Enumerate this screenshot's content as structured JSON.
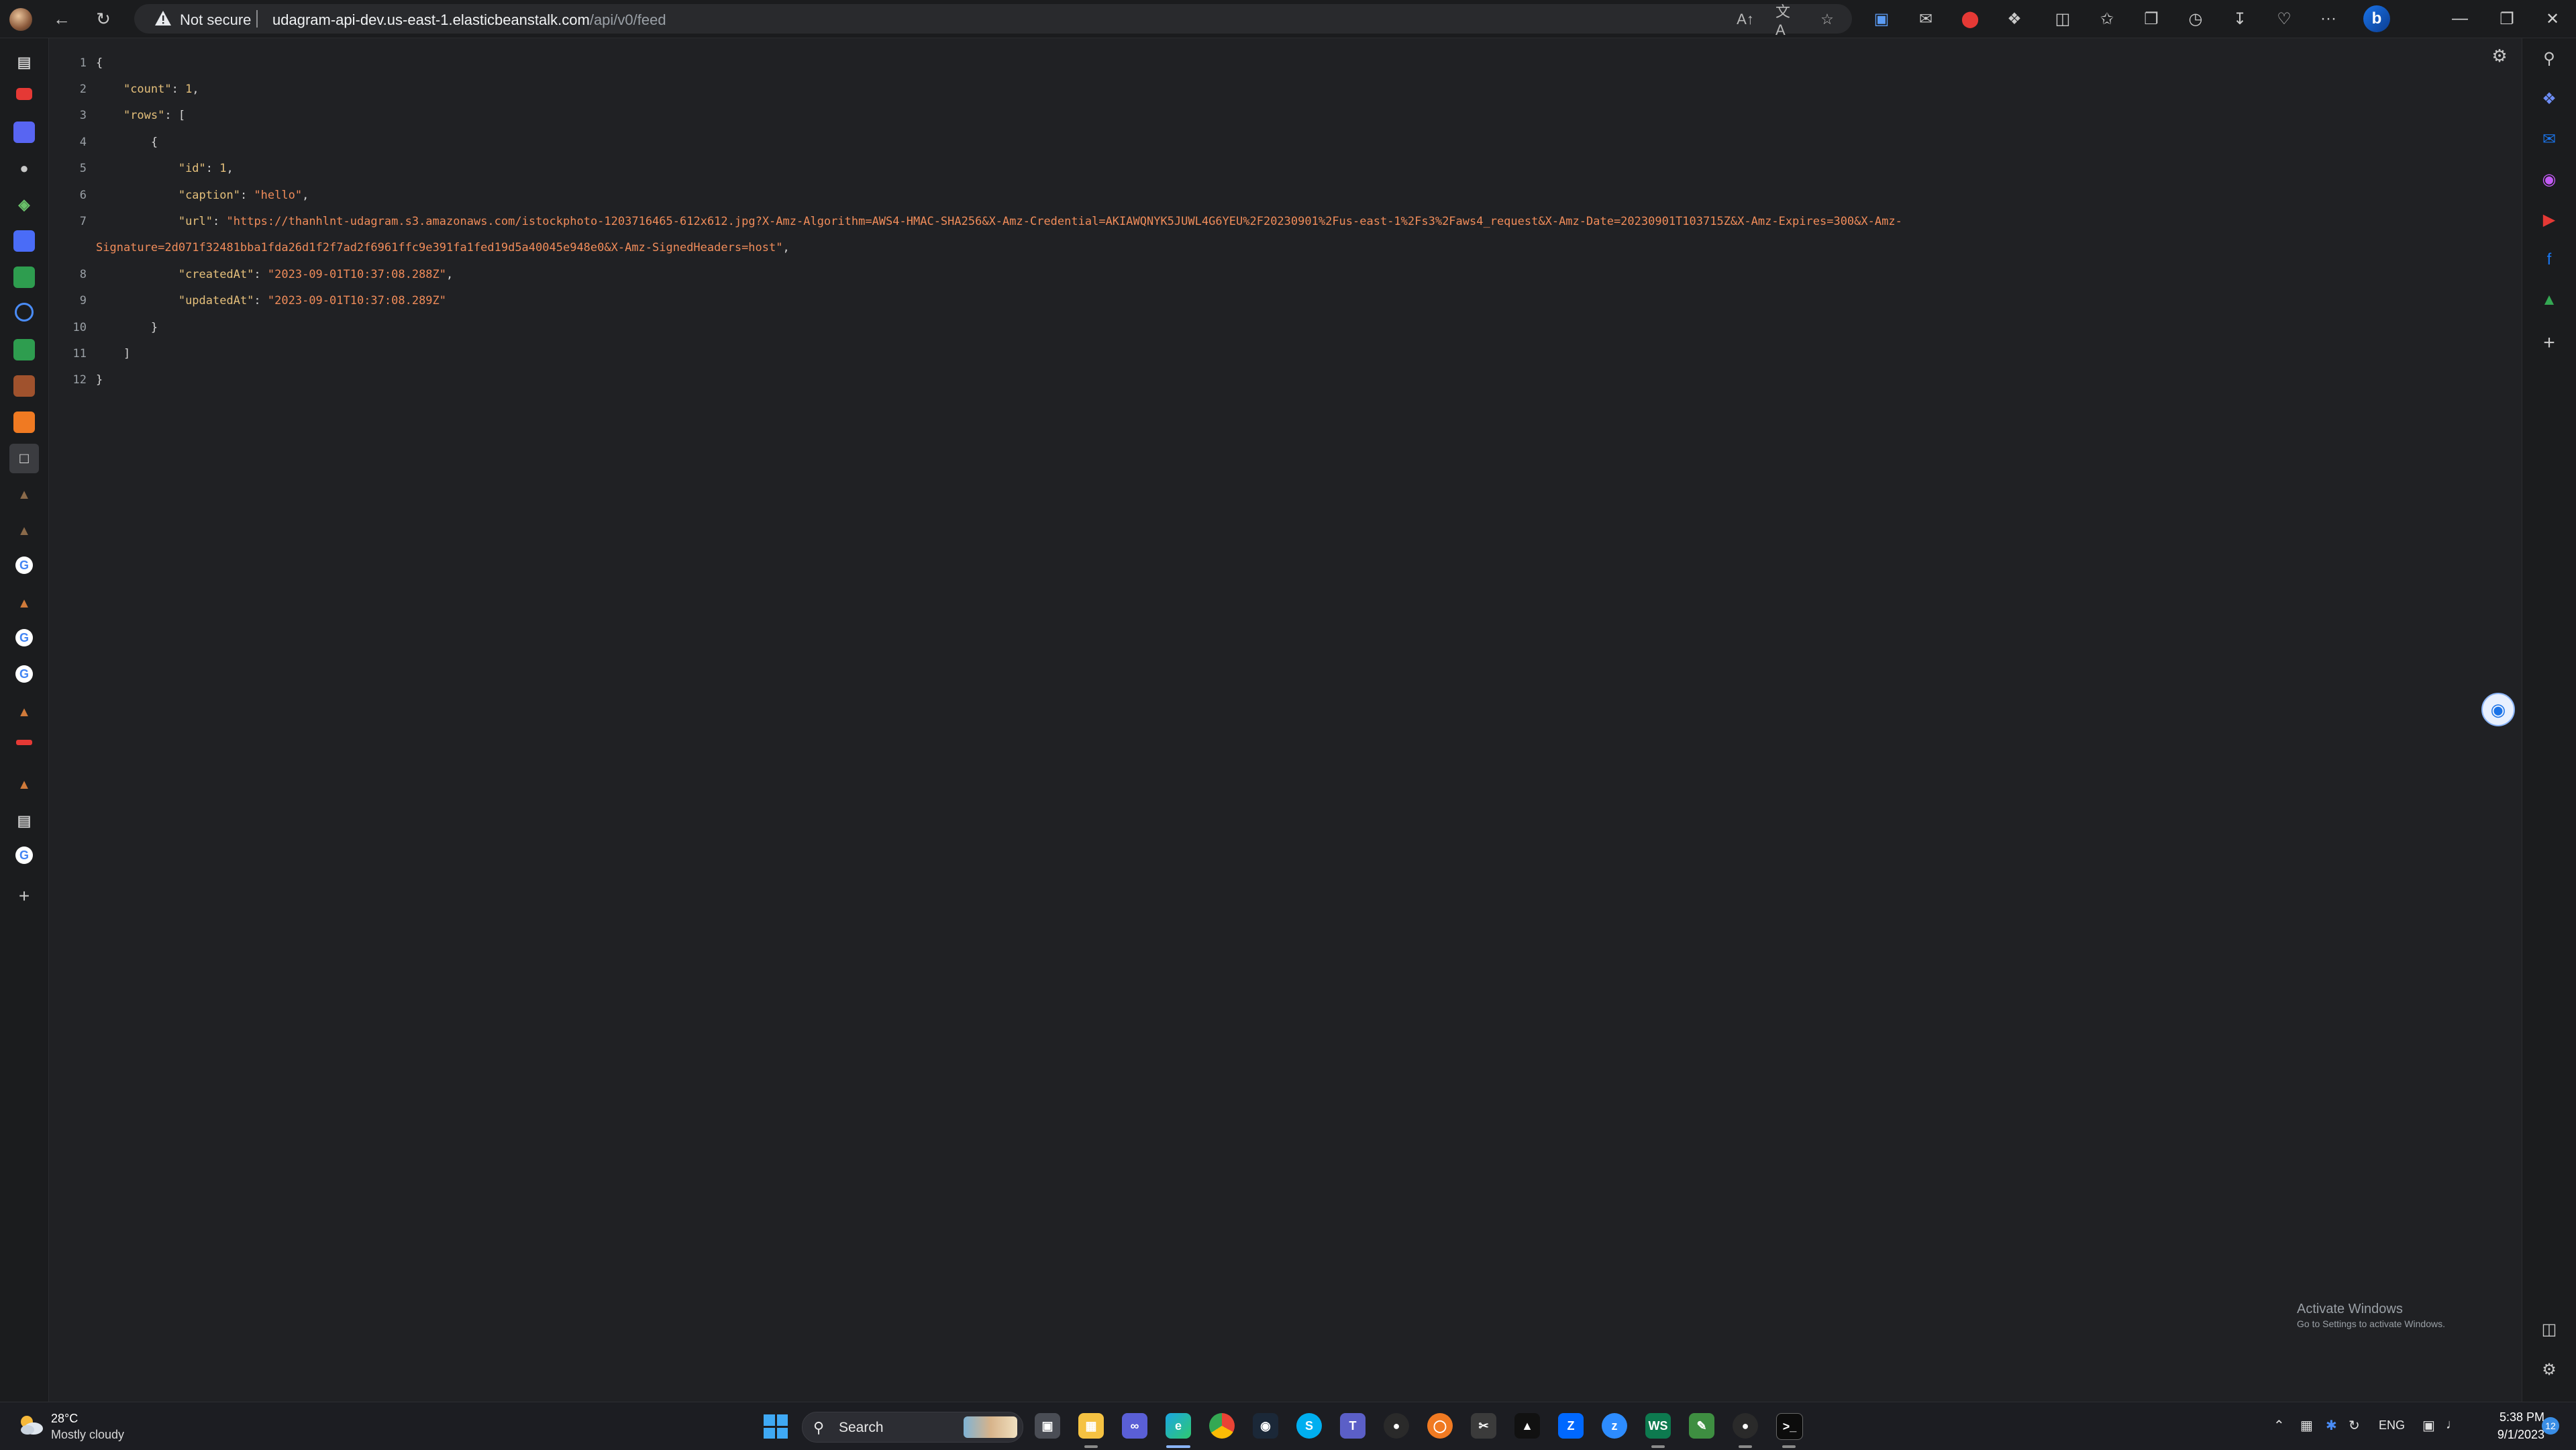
{
  "browser": {
    "security_label": "Not secure",
    "url_host": "udagram-api-dev.us-east-1.elasticbeanstalk.com",
    "url_path": "/api/v0/feed",
    "read_aloud_glyph": "A↑",
    "translate_glyph": "文A",
    "more_glyph": "···",
    "bing_glyph": "b"
  },
  "json_lines": [
    {
      "n": "1"
    },
    {
      "n": "2"
    },
    {
      "n": "3"
    },
    {
      "n": "4"
    },
    {
      "n": "5"
    },
    {
      "n": "6"
    },
    {
      "n": "7"
    },
    {
      "n": ""
    },
    {
      "n": "8"
    },
    {
      "n": "9"
    },
    {
      "n": "10"
    },
    {
      "n": "11"
    },
    {
      "n": "12"
    }
  ],
  "json": {
    "count_key": "\"count\"",
    "count_val": "1",
    "rows_key": "\"rows\"",
    "id_key": "\"id\"",
    "id_val": "1",
    "caption_key": "\"caption\"",
    "caption_val": "\"hello\"",
    "url_key": "\"url\"",
    "url_val_part1": "\"https://thanhlnt-udagram.s3.amazonaws.com/istockphoto-1203716465-612x612.jpg?X-Amz-Algorithm=AWS4-HMAC-SHA256&X-Amz-Credential=AKIAWQNYK5JUWL4G6YEU%2F20230901%2Fus-east-1%2Fs3%2Faws4_request&X-Amz-Date=20230901T103715Z&X-Amz-Expires=300&X-Amz-",
    "url_val_part2": "Signature=2d071f32481bba1fda26d1f2f7ad2f6961ffc9e391fa1fed19d5a40045e948e0&X-Amz-SignedHeaders=host\"",
    "createdAt_key": "\"createdAt\"",
    "createdAt_val": "\"2023-09-01T10:37:08.288Z\"",
    "updatedAt_key": "\"updatedAt\"",
    "updatedAt_val": "\"2023-09-01T10:37:08.289Z\""
  },
  "watermark": {
    "title": "Activate Windows",
    "subtitle": "Go to Settings to activate Windows."
  },
  "taskbar": {
    "temperature": "28°C",
    "condition": "Mostly cloudy",
    "search_label": "Search",
    "language": "ENG",
    "time": "5:38 PM",
    "date": "9/1/2023",
    "notification_count": "12"
  },
  "colors": {
    "page_bg": "#202124",
    "json_key": "#e5c07b",
    "json_string": "#f08c5a",
    "chrome_bg": "#1b1c1e"
  }
}
